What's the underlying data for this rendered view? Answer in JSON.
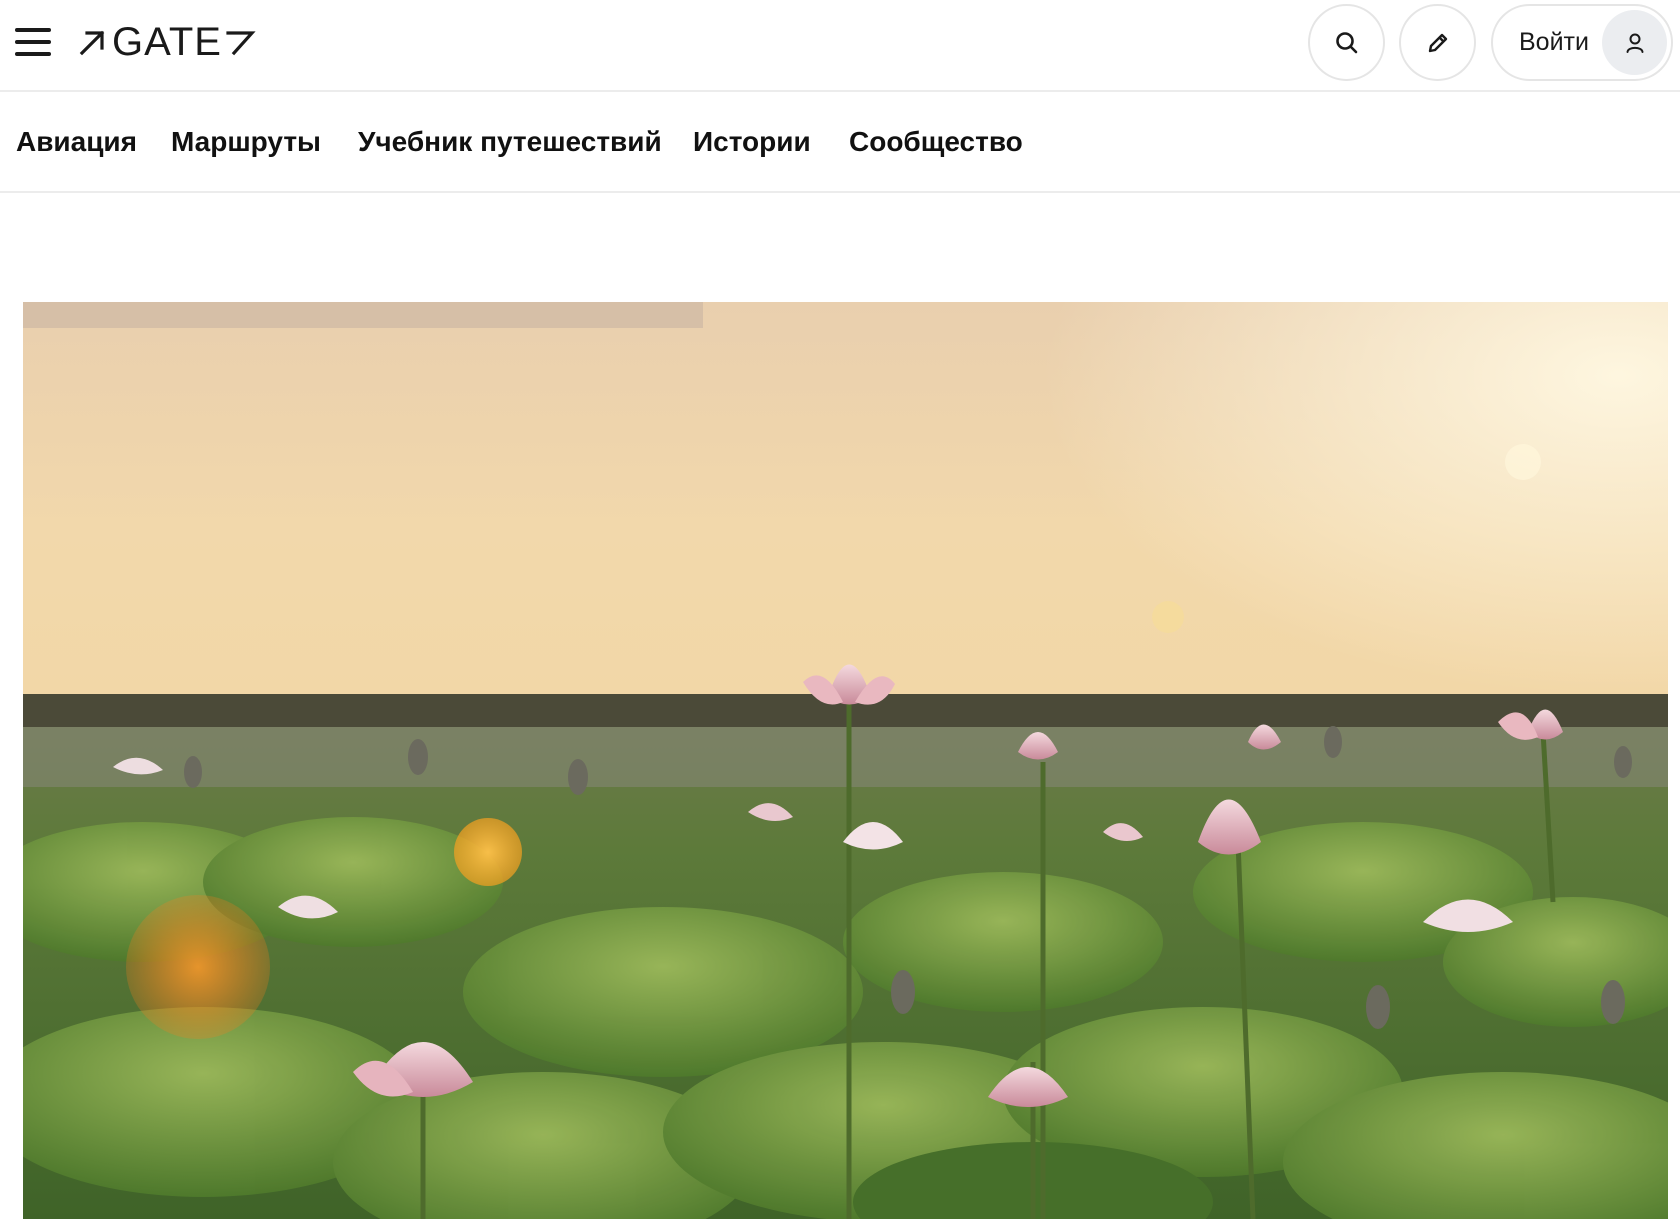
{
  "header": {
    "logo_text": "GATE",
    "menu_icon": "hamburger-menu-icon",
    "search_icon": "search-icon",
    "edit_icon": "pencil-icon",
    "login_label": "Войти",
    "user_icon": "user-icon"
  },
  "nav": {
    "items": [
      {
        "label": "Авиация"
      },
      {
        "label": "Маршруты"
      },
      {
        "label": "Учебник путешествий"
      },
      {
        "label": "Истории"
      },
      {
        "label": "Сообщество"
      }
    ]
  },
  "hero": {
    "image": "lotus-field-sunset-photo"
  },
  "colors": {
    "text": "#111111",
    "border": "#e5e5e5",
    "avatar_bg": "#ebedf0"
  }
}
